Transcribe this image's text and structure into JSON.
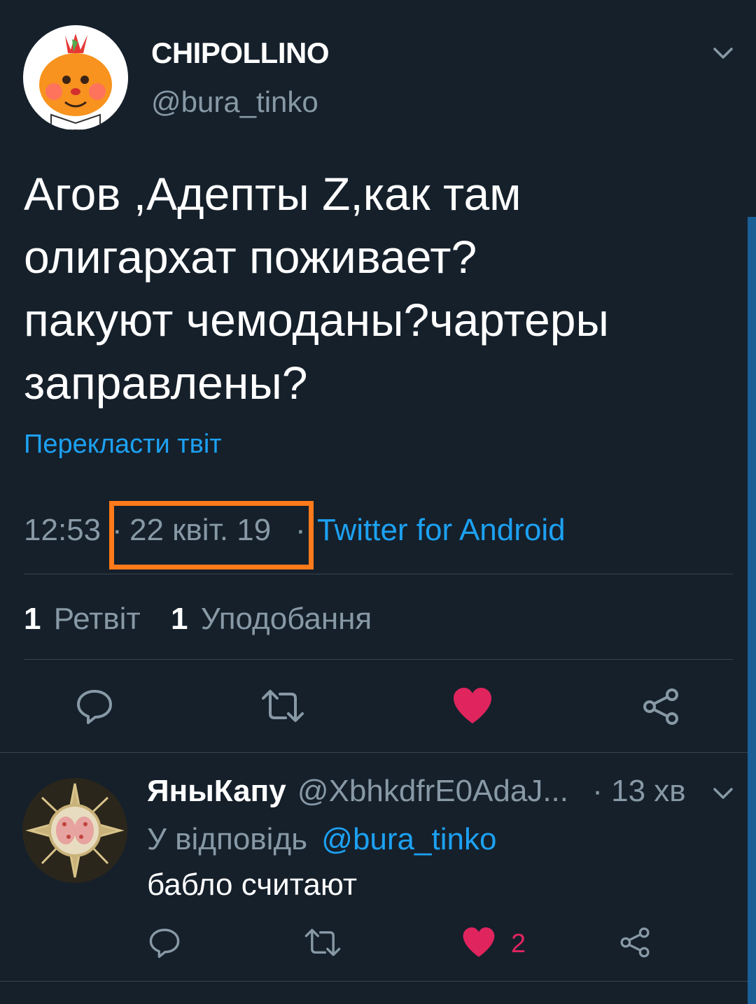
{
  "tweet": {
    "author_name": "CHIPOLLINO",
    "author_handle": "@bura_tinko",
    "text_lines": [
      "Агов ,Адепты Z,как там",
      "олигархат поживает?",
      "пакуют чемоданы?чартеры",
      "заправлены?"
    ],
    "translate_label": "Перекласти твіт",
    "time": "12:53",
    "separator": "·",
    "date": "22 квіт. 19",
    "source": "Twitter for Android",
    "retweet_count": "1",
    "retweet_label": "Ретвіт",
    "like_count": "1",
    "like_label": "Уподобання"
  },
  "reply": {
    "author_name": "ЯныКапу",
    "author_handle": "@XbhkdfrE0AdaJ...",
    "time_ago": "· 13 хв",
    "reply_prefix": "У відповідь",
    "reply_to": "@bura_tinko",
    "text": "бабло считают",
    "like_count": "2"
  },
  "colors": {
    "background": "#15202b",
    "accent": "#1da1f2",
    "muted": "#8899a6",
    "like": "#e0245e",
    "highlight_box": "#ff7a1a",
    "divider": "#38444d"
  },
  "icons": [
    "chevron-down-icon",
    "reply-icon",
    "retweet-icon",
    "heart-icon",
    "share-icon"
  ]
}
